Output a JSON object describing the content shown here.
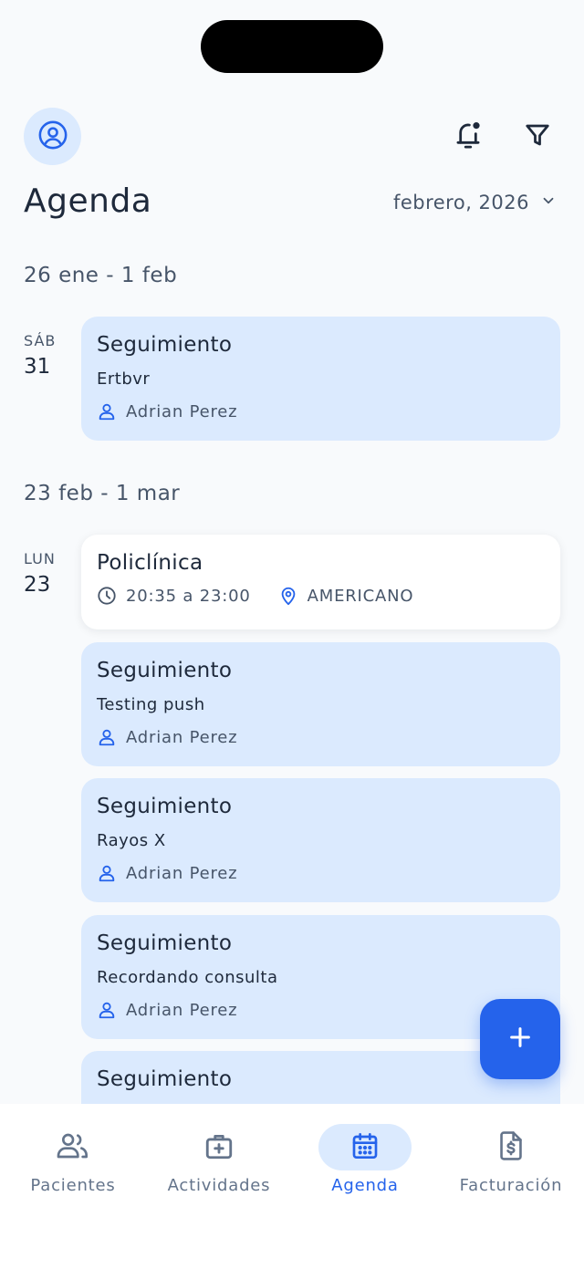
{
  "header": {
    "title": "Agenda",
    "month": "febrero, 2026"
  },
  "weeks": [
    {
      "label": "26 ene - 1 feb",
      "days": [
        {
          "day_name": "SÁB",
          "day_num": "31",
          "events": [
            {
              "title": "Seguimiento",
              "subtitle": "Ertbvr",
              "person": "Adrian Perez"
            }
          ]
        }
      ]
    },
    {
      "label": "23 feb - 1 mar",
      "days": [
        {
          "day_name": "LUN",
          "day_num": "23",
          "events": [
            {
              "title": "Policlínica",
              "time": "20:35 a 23:00",
              "location": "AMERICANO"
            },
            {
              "title": "Seguimiento",
              "subtitle": "Testing push",
              "person": "Adrian Perez"
            },
            {
              "title": "Seguimiento",
              "subtitle": "Rayos X",
              "person": "Adrian Perez"
            },
            {
              "title": "Seguimiento",
              "subtitle": "Recordando consulta",
              "person": "Adrian Perez"
            },
            {
              "title": "Seguimiento"
            }
          ]
        }
      ]
    }
  ],
  "nav": [
    {
      "label": "Pacientes",
      "icon": "users-icon"
    },
    {
      "label": "Actividades",
      "icon": "medical-kit-icon"
    },
    {
      "label": "Agenda",
      "icon": "calendar-icon",
      "active": true
    },
    {
      "label": "Facturación",
      "icon": "invoice-icon"
    }
  ],
  "colors": {
    "accent": "#2563eb",
    "card_bg": "#dbeafe",
    "background": "#f8fafc"
  }
}
